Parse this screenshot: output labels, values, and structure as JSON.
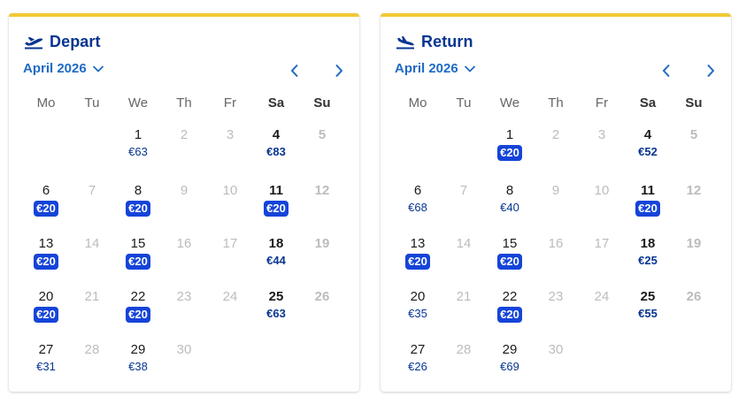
{
  "colors": {
    "accent_yellow": "#f1c933",
    "brand_blue": "#073590",
    "link_blue": "#1f6bc4",
    "badge_blue": "#1544d8"
  },
  "weekdays": [
    "Mo",
    "Tu",
    "We",
    "Th",
    "Fr",
    "Sa",
    "Su"
  ],
  "depart": {
    "icon": "plane-takeoff-icon",
    "title": "Depart",
    "month": "April 2026",
    "days": [
      {
        "d": "1",
        "p": "€63",
        "low": false,
        "disabled": false
      },
      {
        "d": "2",
        "p": "",
        "low": false,
        "disabled": true
      },
      {
        "d": "3",
        "p": "",
        "low": false,
        "disabled": true
      },
      {
        "d": "4",
        "p": "€83",
        "low": false,
        "disabled": false
      },
      {
        "d": "5",
        "p": "",
        "low": false,
        "disabled": true
      },
      {
        "d": "6",
        "p": "€20",
        "low": true,
        "disabled": false
      },
      {
        "d": "7",
        "p": "",
        "low": false,
        "disabled": true
      },
      {
        "d": "8",
        "p": "€20",
        "low": true,
        "disabled": false
      },
      {
        "d": "9",
        "p": "",
        "low": false,
        "disabled": true
      },
      {
        "d": "10",
        "p": "",
        "low": false,
        "disabled": true
      },
      {
        "d": "11",
        "p": "€20",
        "low": true,
        "disabled": false
      },
      {
        "d": "12",
        "p": "",
        "low": false,
        "disabled": true
      },
      {
        "d": "13",
        "p": "€20",
        "low": true,
        "disabled": false
      },
      {
        "d": "14",
        "p": "",
        "low": false,
        "disabled": true
      },
      {
        "d": "15",
        "p": "€20",
        "low": true,
        "disabled": false
      },
      {
        "d": "16",
        "p": "",
        "low": false,
        "disabled": true
      },
      {
        "d": "17",
        "p": "",
        "low": false,
        "disabled": true
      },
      {
        "d": "18",
        "p": "€44",
        "low": false,
        "disabled": false
      },
      {
        "d": "19",
        "p": "",
        "low": false,
        "disabled": true
      },
      {
        "d": "20",
        "p": "€20",
        "low": true,
        "disabled": false
      },
      {
        "d": "21",
        "p": "",
        "low": false,
        "disabled": true
      },
      {
        "d": "22",
        "p": "€20",
        "low": true,
        "disabled": false
      },
      {
        "d": "23",
        "p": "",
        "low": false,
        "disabled": true
      },
      {
        "d": "24",
        "p": "",
        "low": false,
        "disabled": true
      },
      {
        "d": "25",
        "p": "€63",
        "low": false,
        "disabled": false
      },
      {
        "d": "26",
        "p": "",
        "low": false,
        "disabled": true
      },
      {
        "d": "27",
        "p": "€31",
        "low": false,
        "disabled": false
      },
      {
        "d": "28",
        "p": "",
        "low": false,
        "disabled": true
      },
      {
        "d": "29",
        "p": "€38",
        "low": false,
        "disabled": false
      },
      {
        "d": "30",
        "p": "",
        "low": false,
        "disabled": true
      }
    ]
  },
  "return": {
    "icon": "plane-landing-icon",
    "title": "Return",
    "month": "April 2026",
    "days": [
      {
        "d": "1",
        "p": "€20",
        "low": true,
        "disabled": false
      },
      {
        "d": "2",
        "p": "",
        "low": false,
        "disabled": true
      },
      {
        "d": "3",
        "p": "",
        "low": false,
        "disabled": true
      },
      {
        "d": "4",
        "p": "€52",
        "low": false,
        "disabled": false
      },
      {
        "d": "5",
        "p": "",
        "low": false,
        "disabled": true
      },
      {
        "d": "6",
        "p": "€68",
        "low": false,
        "disabled": false
      },
      {
        "d": "7",
        "p": "",
        "low": false,
        "disabled": true
      },
      {
        "d": "8",
        "p": "€40",
        "low": false,
        "disabled": false
      },
      {
        "d": "9",
        "p": "",
        "low": false,
        "disabled": true
      },
      {
        "d": "10",
        "p": "",
        "low": false,
        "disabled": true
      },
      {
        "d": "11",
        "p": "€20",
        "low": true,
        "disabled": false
      },
      {
        "d": "12",
        "p": "",
        "low": false,
        "disabled": true
      },
      {
        "d": "13",
        "p": "€20",
        "low": true,
        "disabled": false
      },
      {
        "d": "14",
        "p": "",
        "low": false,
        "disabled": true
      },
      {
        "d": "15",
        "p": "€20",
        "low": true,
        "disabled": false
      },
      {
        "d": "16",
        "p": "",
        "low": false,
        "disabled": true
      },
      {
        "d": "17",
        "p": "",
        "low": false,
        "disabled": true
      },
      {
        "d": "18",
        "p": "€25",
        "low": false,
        "disabled": false
      },
      {
        "d": "19",
        "p": "",
        "low": false,
        "disabled": true
      },
      {
        "d": "20",
        "p": "€35",
        "low": false,
        "disabled": false
      },
      {
        "d": "21",
        "p": "",
        "low": false,
        "disabled": true
      },
      {
        "d": "22",
        "p": "€20",
        "low": true,
        "disabled": false
      },
      {
        "d": "23",
        "p": "",
        "low": false,
        "disabled": true
      },
      {
        "d": "24",
        "p": "",
        "low": false,
        "disabled": true
      },
      {
        "d": "25",
        "p": "€55",
        "low": false,
        "disabled": false
      },
      {
        "d": "26",
        "p": "",
        "low": false,
        "disabled": true
      },
      {
        "d": "27",
        "p": "€26",
        "low": false,
        "disabled": false
      },
      {
        "d": "28",
        "p": "",
        "low": false,
        "disabled": true
      },
      {
        "d": "29",
        "p": "€69",
        "low": false,
        "disabled": false
      },
      {
        "d": "30",
        "p": "",
        "low": false,
        "disabled": true
      }
    ]
  }
}
